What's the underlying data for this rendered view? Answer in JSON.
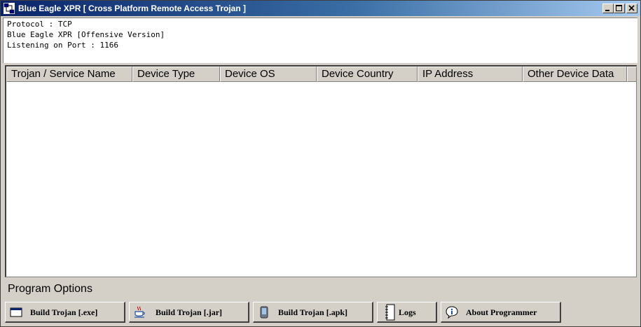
{
  "window": {
    "title": "Blue Eagle XPR  [ Cross Platform Remote Access Trojan ]"
  },
  "info": {
    "line1": "Protocol : TCP",
    "line2": "Blue Eagle XPR [Offensive Version]",
    "line3": "Listening on Port : 1166"
  },
  "table": {
    "columns": [
      "Trojan / Service Name",
      "Device Type",
      "Device OS",
      "Device Country",
      "IP Address",
      "Other Device Data"
    ],
    "rows": []
  },
  "options": {
    "label": "Program Options",
    "buttons": [
      {
        "label": "Build Trojan [.exe]",
        "icon": "window-exe-icon"
      },
      {
        "label": "Build Trojan [.jar]",
        "icon": "java-cup-icon"
      },
      {
        "label": "Build Trojan [.apk]",
        "icon": "phone-icon"
      },
      {
        "label": "Logs",
        "icon": "notebook-icon"
      },
      {
        "label": "About Programmer",
        "icon": "info-icon"
      }
    ]
  },
  "colors": {
    "titlebar_start": "#0a246a",
    "titlebar_end": "#a6caf0",
    "face": "#d4d0c8"
  }
}
